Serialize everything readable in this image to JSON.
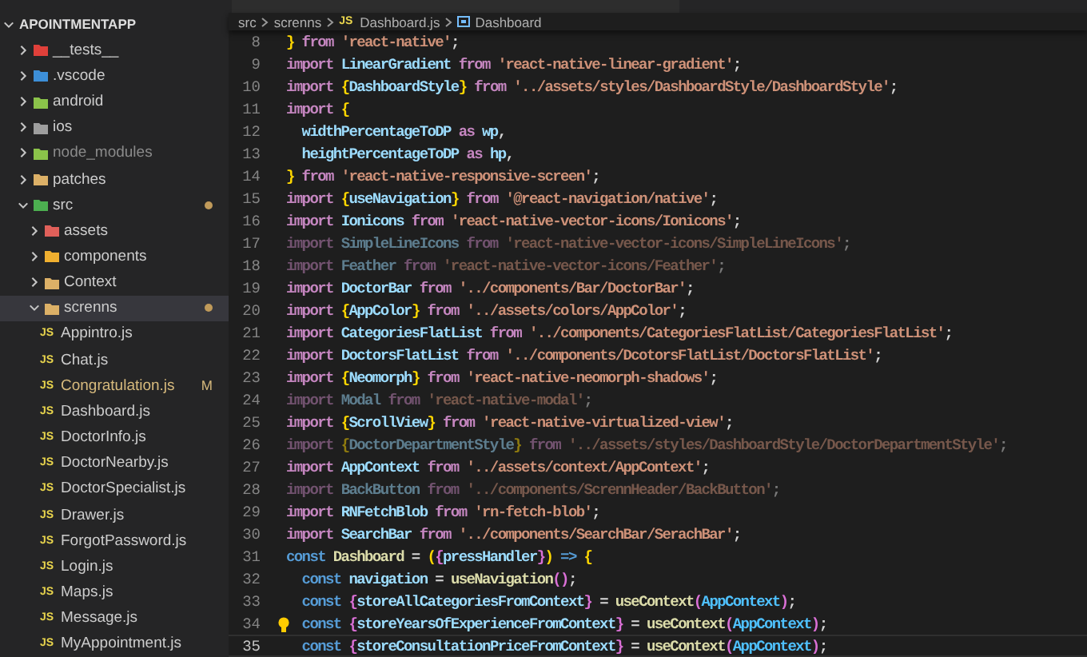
{
  "explorer": {
    "title": "APOINTMENTAPP",
    "expanded": true,
    "items": [
      {
        "kind": "folder",
        "name": "__tests__",
        "color": "#e0403a",
        "expanded": false,
        "selected": false
      },
      {
        "kind": "folder",
        "name": ".vscode",
        "color": "#3d8fd8",
        "expanded": false,
        "selected": false
      },
      {
        "kind": "folder",
        "name": "android",
        "color": "#8bc34a",
        "expanded": false,
        "selected": false
      },
      {
        "kind": "folder",
        "name": "ios",
        "color": "#9e9e9e",
        "expanded": false,
        "selected": false
      },
      {
        "kind": "folder",
        "name": "node_modules",
        "color": "#8bc34a",
        "expanded": false,
        "selected": false,
        "ignored": true
      },
      {
        "kind": "folder",
        "name": "patches",
        "color": "#dcb067",
        "expanded": false,
        "selected": false
      },
      {
        "kind": "folder",
        "name": "src",
        "color": "#4caf50",
        "expanded": true,
        "selected": false,
        "dot": true,
        "children": [
          {
            "kind": "folder",
            "name": "assets",
            "color": "#e0605a",
            "expanded": false,
            "selected": false
          },
          {
            "kind": "folder",
            "name": "components",
            "color": "#f0b030",
            "expanded": false,
            "selected": false
          },
          {
            "kind": "folder",
            "name": "Context",
            "color": "#dcb067",
            "expanded": false,
            "selected": false
          },
          {
            "kind": "folder",
            "name": "screnns",
            "color": "#dcb067",
            "expanded": true,
            "selected": true,
            "dot": true,
            "children": [
              {
                "kind": "file",
                "badge": "JS",
                "name": "Appintro.js",
                "selected": false
              },
              {
                "kind": "file",
                "badge": "JS",
                "name": "Chat.js",
                "selected": false
              },
              {
                "kind": "file",
                "badge": "JS",
                "name": "Congratulation.js",
                "selected": false,
                "status": "M"
              },
              {
                "kind": "file",
                "badge": "JS",
                "name": "Dashboard.js",
                "selected": false
              },
              {
                "kind": "file",
                "badge": "JS",
                "name": "DoctorInfo.js",
                "selected": false
              },
              {
                "kind": "file",
                "badge": "JS",
                "name": "DoctorNearby.js",
                "selected": false
              },
              {
                "kind": "file",
                "badge": "JS",
                "name": "DoctorSpecialist.js",
                "selected": false
              },
              {
                "kind": "file",
                "badge": "JS",
                "name": "Drawer.js",
                "selected": false
              },
              {
                "kind": "file",
                "badge": "JS",
                "name": "ForgotPassword.js",
                "selected": false
              },
              {
                "kind": "file",
                "badge": "JS",
                "name": "Login.js",
                "selected": false
              },
              {
                "kind": "file",
                "badge": "JS",
                "name": "Maps.js",
                "selected": false
              },
              {
                "kind": "file",
                "badge": "JS",
                "name": "Message.js",
                "selected": false
              },
              {
                "kind": "file",
                "badge": "JS",
                "name": "MyAppointment.js",
                "selected": false
              }
            ]
          }
        ]
      }
    ]
  },
  "breadcrumb": [
    {
      "kind": "folder",
      "text": "src"
    },
    {
      "kind": "folder",
      "text": "screnns"
    },
    {
      "kind": "file",
      "badge": "JS",
      "text": "Dashboard.js"
    },
    {
      "kind": "symbol",
      "text": "Dashboard"
    }
  ],
  "code": [
    {
      "number": "8",
      "faded": false,
      "current": false,
      "tokens": [
        {
          "kind": "b1",
          "text": "}"
        },
        {
          "kind": "kw",
          "text": " from "
        },
        {
          "kind": "str",
          "text": "'react-native'"
        },
        {
          "kind": "p",
          "text": ";"
        }
      ]
    },
    {
      "number": "9",
      "faded": false,
      "current": false,
      "tokens": [
        {
          "kind": "kw",
          "text": "import "
        },
        {
          "kind": "var",
          "text": "LinearGradient"
        },
        {
          "kind": "kw",
          "text": " from "
        },
        {
          "kind": "str",
          "text": "'react-native-linear-gradient'"
        },
        {
          "kind": "p",
          "text": ";"
        }
      ]
    },
    {
      "number": "10",
      "faded": false,
      "current": false,
      "tokens": [
        {
          "kind": "kw",
          "text": "import "
        },
        {
          "kind": "b1",
          "text": "{"
        },
        {
          "kind": "var",
          "text": "DashboardStyle"
        },
        {
          "kind": "b1",
          "text": "}"
        },
        {
          "kind": "kw",
          "text": " from "
        },
        {
          "kind": "str",
          "text": "'../assets/styles/DashboardStyle/DashboardStyle'"
        },
        {
          "kind": "p",
          "text": ";"
        }
      ]
    },
    {
      "number": "11",
      "faded": false,
      "current": false,
      "tokens": [
        {
          "kind": "kw",
          "text": "import "
        },
        {
          "kind": "b1",
          "text": "{"
        }
      ]
    },
    {
      "number": "12",
      "faded": false,
      "current": false,
      "tokens": [
        {
          "kind": "var",
          "text": "  widthPercentageToDP"
        },
        {
          "kind": "kw",
          "text": " as "
        },
        {
          "kind": "var",
          "text": "wp"
        },
        {
          "kind": "p",
          "text": ","
        }
      ]
    },
    {
      "number": "13",
      "faded": false,
      "current": false,
      "tokens": [
        {
          "kind": "var",
          "text": "  heightPercentageToDP"
        },
        {
          "kind": "kw",
          "text": " as "
        },
        {
          "kind": "var",
          "text": "hp"
        },
        {
          "kind": "p",
          "text": ","
        }
      ]
    },
    {
      "number": "14",
      "faded": false,
      "current": false,
      "tokens": [
        {
          "kind": "b1",
          "text": "}"
        },
        {
          "kind": "kw",
          "text": " from "
        },
        {
          "kind": "str",
          "text": "'react-native-responsive-screen'"
        },
        {
          "kind": "p",
          "text": ";"
        }
      ]
    },
    {
      "number": "15",
      "faded": false,
      "current": false,
      "tokens": [
        {
          "kind": "kw",
          "text": "import "
        },
        {
          "kind": "b1",
          "text": "{"
        },
        {
          "kind": "var",
          "text": "useNavigation"
        },
        {
          "kind": "b1",
          "text": "}"
        },
        {
          "kind": "kw",
          "text": " from "
        },
        {
          "kind": "str",
          "text": "'@react-navigation/native'"
        },
        {
          "kind": "p",
          "text": ";"
        }
      ]
    },
    {
      "number": "16",
      "faded": false,
      "current": false,
      "tokens": [
        {
          "kind": "kw",
          "text": "import "
        },
        {
          "kind": "var",
          "text": "Ionicons"
        },
        {
          "kind": "kw",
          "text": " from "
        },
        {
          "kind": "str",
          "text": "'react-native-vector-icons/Ionicons'"
        },
        {
          "kind": "p",
          "text": ";"
        }
      ]
    },
    {
      "number": "17",
      "faded": true,
      "current": false,
      "tokens": [
        {
          "kind": "kw",
          "text": "import "
        },
        {
          "kind": "var",
          "text": "SimpleLineIcons"
        },
        {
          "kind": "kw",
          "text": " from "
        },
        {
          "kind": "str",
          "text": "'react-native-vector-icons/SimpleLineIcons'"
        },
        {
          "kind": "p",
          "text": ";"
        }
      ]
    },
    {
      "number": "18",
      "faded": true,
      "current": false,
      "tokens": [
        {
          "kind": "kw",
          "text": "import "
        },
        {
          "kind": "var",
          "text": "Feather"
        },
        {
          "kind": "kw",
          "text": " from "
        },
        {
          "kind": "str",
          "text": "'react-native-vector-icons/Feather'"
        },
        {
          "kind": "p",
          "text": ";"
        }
      ]
    },
    {
      "number": "19",
      "faded": false,
      "current": false,
      "tokens": [
        {
          "kind": "kw",
          "text": "import "
        },
        {
          "kind": "var",
          "text": "DoctorBar"
        },
        {
          "kind": "kw",
          "text": " from "
        },
        {
          "kind": "str",
          "text": "'../components/Bar/DoctorBar'"
        },
        {
          "kind": "p",
          "text": ";"
        }
      ]
    },
    {
      "number": "20",
      "faded": false,
      "current": false,
      "tokens": [
        {
          "kind": "kw",
          "text": "import "
        },
        {
          "kind": "b1",
          "text": "{"
        },
        {
          "kind": "var",
          "text": "AppColor"
        },
        {
          "kind": "b1",
          "text": "}"
        },
        {
          "kind": "kw",
          "text": " from "
        },
        {
          "kind": "str",
          "text": "'../assets/colors/AppColor'"
        },
        {
          "kind": "p",
          "text": ";"
        }
      ]
    },
    {
      "number": "21",
      "faded": false,
      "current": false,
      "tokens": [
        {
          "kind": "kw",
          "text": "import "
        },
        {
          "kind": "var",
          "text": "CategoriesFlatList"
        },
        {
          "kind": "kw",
          "text": " from "
        },
        {
          "kind": "str",
          "text": "'../components/CategoriesFlatList/CategoriesFlatList'"
        },
        {
          "kind": "p",
          "text": ";"
        }
      ]
    },
    {
      "number": "22",
      "faded": false,
      "current": false,
      "tokens": [
        {
          "kind": "kw",
          "text": "import "
        },
        {
          "kind": "var",
          "text": "DoctorsFlatList"
        },
        {
          "kind": "kw",
          "text": " from "
        },
        {
          "kind": "str",
          "text": "'../components/DcotorsFlatList/DoctorsFlatList'"
        },
        {
          "kind": "p",
          "text": ";"
        }
      ]
    },
    {
      "number": "23",
      "faded": false,
      "current": false,
      "tokens": [
        {
          "kind": "kw",
          "text": "import "
        },
        {
          "kind": "b1",
          "text": "{"
        },
        {
          "kind": "var",
          "text": "Neomorph"
        },
        {
          "kind": "b1",
          "text": "}"
        },
        {
          "kind": "kw",
          "text": " from "
        },
        {
          "kind": "str",
          "text": "'react-native-neomorph-shadows'"
        },
        {
          "kind": "p",
          "text": ";"
        }
      ]
    },
    {
      "number": "24",
      "faded": true,
      "current": false,
      "tokens": [
        {
          "kind": "kw",
          "text": "import "
        },
        {
          "kind": "var",
          "text": "Modal"
        },
        {
          "kind": "kw",
          "text": " from "
        },
        {
          "kind": "str",
          "text": "'react-native-modal'"
        },
        {
          "kind": "p",
          "text": ";"
        }
      ]
    },
    {
      "number": "25",
      "faded": false,
      "current": false,
      "tokens": [
        {
          "kind": "kw",
          "text": "import "
        },
        {
          "kind": "b1",
          "text": "{"
        },
        {
          "kind": "var",
          "text": "ScrollView"
        },
        {
          "kind": "b1",
          "text": "}"
        },
        {
          "kind": "kw",
          "text": " from "
        },
        {
          "kind": "str",
          "text": "'react-native-virtualized-view'"
        },
        {
          "kind": "p",
          "text": ";"
        }
      ]
    },
    {
      "number": "26",
      "faded": true,
      "current": false,
      "tokens": [
        {
          "kind": "kw",
          "text": "import "
        },
        {
          "kind": "b1",
          "text": "{"
        },
        {
          "kind": "var",
          "text": "DoctorDepartmentStyle"
        },
        {
          "kind": "b1",
          "text": "}"
        },
        {
          "kind": "kw",
          "text": " from "
        },
        {
          "kind": "str",
          "text": "'../assets/styles/DashboardStyle/DoctorDepartmentStyle'"
        },
        {
          "kind": "p",
          "text": ";"
        }
      ]
    },
    {
      "number": "27",
      "faded": false,
      "current": false,
      "tokens": [
        {
          "kind": "kw",
          "text": "import "
        },
        {
          "kind": "var",
          "text": "AppContext"
        },
        {
          "kind": "kw",
          "text": " from "
        },
        {
          "kind": "str",
          "text": "'../assets/context/AppContext'"
        },
        {
          "kind": "p",
          "text": ";"
        }
      ]
    },
    {
      "number": "28",
      "faded": true,
      "current": false,
      "tokens": [
        {
          "kind": "kw",
          "text": "import "
        },
        {
          "kind": "var",
          "text": "BackButton"
        },
        {
          "kind": "kw",
          "text": " from "
        },
        {
          "kind": "str",
          "text": "'../components/ScrennHeader/BackButton'"
        },
        {
          "kind": "p",
          "text": ";"
        }
      ]
    },
    {
      "number": "29",
      "faded": false,
      "current": false,
      "tokens": [
        {
          "kind": "kw",
          "text": "import "
        },
        {
          "kind": "var",
          "text": "RNFetchBlob"
        },
        {
          "kind": "kw",
          "text": " from "
        },
        {
          "kind": "str",
          "text": "'rn-fetch-blob'"
        },
        {
          "kind": "p",
          "text": ";"
        }
      ]
    },
    {
      "number": "30",
      "faded": false,
      "current": false,
      "tokens": [
        {
          "kind": "kw",
          "text": "import "
        },
        {
          "kind": "var",
          "text": "SearchBar"
        },
        {
          "kind": "kw",
          "text": " from "
        },
        {
          "kind": "str",
          "text": "'../components/SearchBar/SerachBar'"
        },
        {
          "kind": "p",
          "text": ";"
        }
      ]
    },
    {
      "number": "31",
      "faded": false,
      "current": false,
      "tokens": [
        {
          "kind": "st",
          "text": "const "
        },
        {
          "kind": "fn",
          "text": "Dashboard"
        },
        {
          "kind": "p",
          "text": " = "
        },
        {
          "kind": "b1",
          "text": "("
        },
        {
          "kind": "b2",
          "text": "{"
        },
        {
          "kind": "var",
          "text": "pressHandler"
        },
        {
          "kind": "b2",
          "text": "}"
        },
        {
          "kind": "b1",
          "text": ")"
        },
        {
          "kind": "st",
          "text": " => "
        },
        {
          "kind": "b1",
          "text": "{"
        }
      ]
    },
    {
      "number": "32",
      "faded": false,
      "current": false,
      "tokens": [
        {
          "kind": "st",
          "text": "  const "
        },
        {
          "kind": "var",
          "text": "navigation"
        },
        {
          "kind": "p",
          "text": " = "
        },
        {
          "kind": "fn",
          "text": "useNavigation"
        },
        {
          "kind": "b2",
          "text": "()"
        },
        {
          "kind": "p",
          "text": ";"
        }
      ]
    },
    {
      "number": "33",
      "faded": false,
      "current": false,
      "tokens": [
        {
          "kind": "st",
          "text": "  const "
        },
        {
          "kind": "b2",
          "text": "{"
        },
        {
          "kind": "var",
          "text": "storeAllCategoriesFromContext"
        },
        {
          "kind": "b2",
          "text": "}"
        },
        {
          "kind": "p",
          "text": " = "
        },
        {
          "kind": "fn",
          "text": "useContext"
        },
        {
          "kind": "b2",
          "text": "("
        },
        {
          "kind": "cls",
          "text": "AppContext"
        },
        {
          "kind": "b2",
          "text": ")"
        },
        {
          "kind": "p",
          "text": ";"
        }
      ]
    },
    {
      "number": "34",
      "faded": false,
      "current": false,
      "lightbulb": true,
      "tokens": [
        {
          "kind": "st",
          "text": "  const "
        },
        {
          "kind": "b2",
          "text": "{"
        },
        {
          "kind": "var",
          "text": "storeYearsOfExperienceFromContext"
        },
        {
          "kind": "b2",
          "text": "}"
        },
        {
          "kind": "p",
          "text": " = "
        },
        {
          "kind": "fn",
          "text": "useContext"
        },
        {
          "kind": "b2",
          "text": "("
        },
        {
          "kind": "cls",
          "text": "AppContext"
        },
        {
          "kind": "b2",
          "text": ")"
        },
        {
          "kind": "p",
          "text": ";"
        }
      ]
    },
    {
      "number": "35",
      "faded": false,
      "current": true,
      "tokens": [
        {
          "kind": "st",
          "text": "  const "
        },
        {
          "kind": "b2",
          "text": "{"
        },
        {
          "kind": "var",
          "text": "storeConsultationPriceFromContext"
        },
        {
          "kind": "b2",
          "text": "}"
        },
        {
          "kind": "p",
          "text": " = "
        },
        {
          "kind": "fn",
          "text": "useContext"
        },
        {
          "kind": "b2",
          "text": "("
        },
        {
          "kind": "cls",
          "text": "AppContext"
        },
        {
          "kind": "b2",
          "text": ")"
        },
        {
          "kind": "p",
          "text": ";"
        }
      ]
    }
  ]
}
